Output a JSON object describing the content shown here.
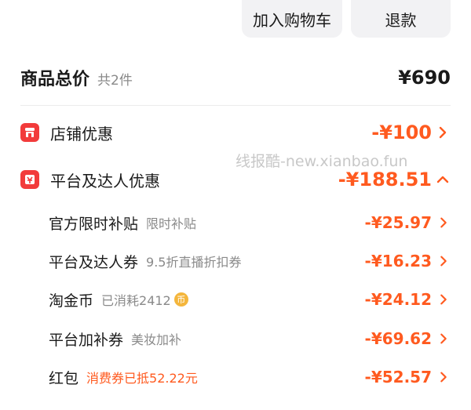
{
  "buttons": {
    "add_to_cart": "加入购物车",
    "refund": "退款"
  },
  "summary": {
    "label": "商品总价",
    "count": "共2件",
    "value": "¥690"
  },
  "sections": [
    {
      "label": "店铺优惠",
      "value": "-¥100"
    },
    {
      "label": "平台及达人优惠",
      "value": "-¥188.51"
    }
  ],
  "watermark": "线报酷-new.xianbao.fun",
  "sub_items": [
    {
      "label": "官方限时补贴",
      "note": "限时补贴",
      "value": "-¥25.97"
    },
    {
      "label": "平台及达人券",
      "note": "9.5折直播折扣券",
      "value": "-¥16.23"
    },
    {
      "label": "淘金币",
      "note": "已消耗2412",
      "coin": "币",
      "value": "-¥24.12"
    },
    {
      "label": "平台加补券",
      "note": "美妆加补",
      "value": "-¥69.62"
    },
    {
      "label": "红包",
      "note": "消费券已抵52.22元",
      "value": "-¥52.57"
    }
  ],
  "colors": {
    "accent": "#ff5a1f",
    "icon_red": "#f23b3b",
    "muted": "#8a8a8a",
    "button_bg": "#f2f2f4"
  }
}
